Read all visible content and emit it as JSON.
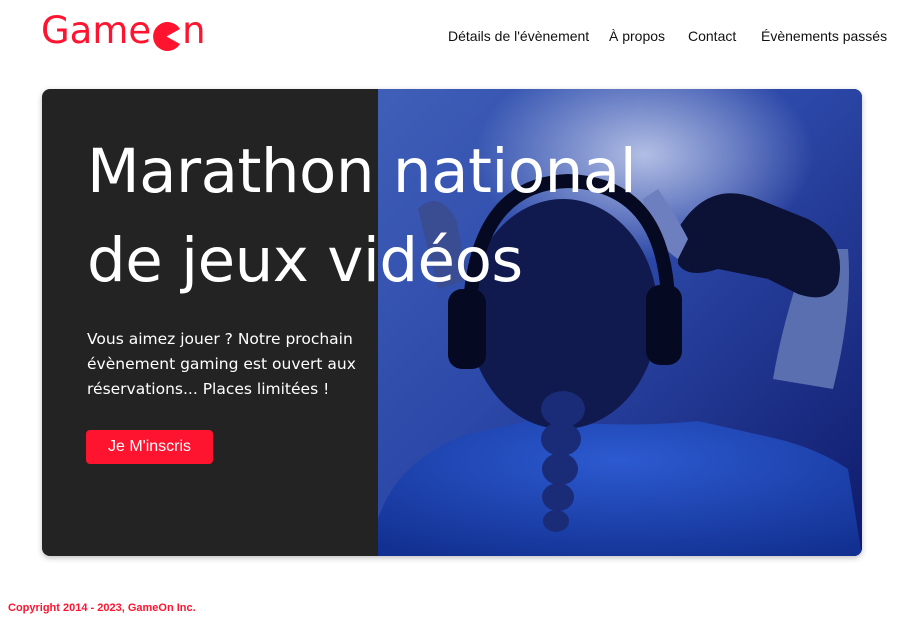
{
  "brand": {
    "name_left": "Game",
    "name_right": "n",
    "logo_icon": "pacman-o-icon",
    "color": "#fe142f"
  },
  "nav": {
    "items": [
      {
        "label": "Détails de l'évènement"
      },
      {
        "label": "À propos"
      },
      {
        "label": "Contact"
      },
      {
        "label": "Évènements passés"
      }
    ]
  },
  "hero": {
    "title_line1": "Marathon national",
    "title_line2": "de jeux vidéos",
    "description": "Vous aimez jouer ? Notre prochain évènement gaming est ouvert aux réservations... Places limitées !",
    "cta_label": "Je M'inscris",
    "image_subject": "gamer-with-headset-and-controller"
  },
  "footer": {
    "copyright": "Copyright 2014 - 2023, GameOn Inc."
  }
}
